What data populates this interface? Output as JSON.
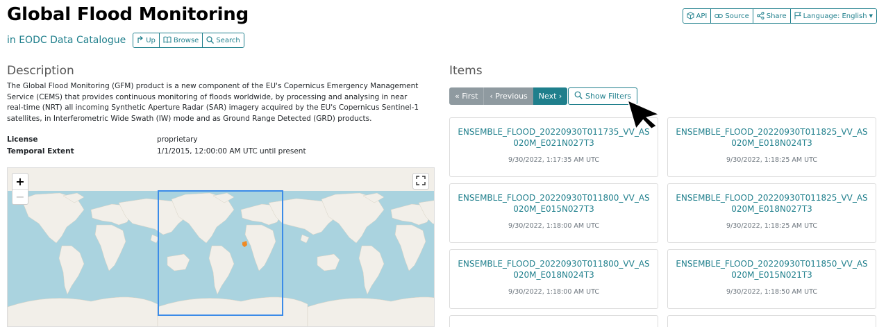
{
  "header": {
    "title": "Global Flood Monitoring",
    "catalog_link": "in EODC Data Catalogue",
    "nav_buttons": [
      "Up",
      "Browse",
      "Search"
    ],
    "top_buttons": [
      "API",
      "Source",
      "Share",
      "Language: English"
    ]
  },
  "description": {
    "heading": "Description",
    "text": "The Global Flood Monitoring (GFM) product is a new component of the EU's Copernicus Emergency Management Service (CEMS) that provides continuous monitoring of floods worldwide, by processing and analysing in near real-time (NRT) all incoming Synthetic Aperture Radar (SAR) imagery acquired by the EU's Copernicus Sentinel-1 satellites, in Interferometric Wide Swath (IW) mode and as Ground Range Detected (GRD) products.",
    "license_label": "License",
    "license_value": "proprietary",
    "extent_label": "Temporal Extent",
    "extent_value": "1/1/2015, 12:00:00 AM UTC until present"
  },
  "map": {
    "zoom_in": "+",
    "zoom_out": "−",
    "bbox_color": "#3b8be8",
    "marker_color": "#f08a24",
    "water_color": "#aad3df",
    "land_color": "#f2efe9"
  },
  "items": {
    "heading": "Items",
    "pager": {
      "first": "« First",
      "previous": "‹ Previous",
      "next": "Next ›"
    },
    "filters_label": "Show Filters",
    "cards": [
      {
        "title": "ENSEMBLE_FLOOD_20220930T011735_VV_AS020M_E021N027T3",
        "date": "9/30/2022, 1:17:35 AM UTC"
      },
      {
        "title": "ENSEMBLE_FLOOD_20220930T011825_VV_AS020M_E018N024T3",
        "date": "9/30/2022, 1:18:25 AM UTC"
      },
      {
        "title": "ENSEMBLE_FLOOD_20220930T011800_VV_AS020M_E015N027T3",
        "date": "9/30/2022, 1:18:00 AM UTC"
      },
      {
        "title": "ENSEMBLE_FLOOD_20220930T011825_VV_AS020M_E018N027T3",
        "date": "9/30/2022, 1:18:25 AM UTC"
      },
      {
        "title": "ENSEMBLE_FLOOD_20220930T011800_VV_AS020M_E018N024T3",
        "date": "9/30/2022, 1:18:00 AM UTC"
      },
      {
        "title": "ENSEMBLE_FLOOD_20220930T011850_VV_AS020M_E015N021T3",
        "date": "9/30/2022, 1:18:50 AM UTC"
      }
    ]
  },
  "colors": {
    "accent": "#1f7f8c",
    "disabled": "#8f9aa0"
  }
}
